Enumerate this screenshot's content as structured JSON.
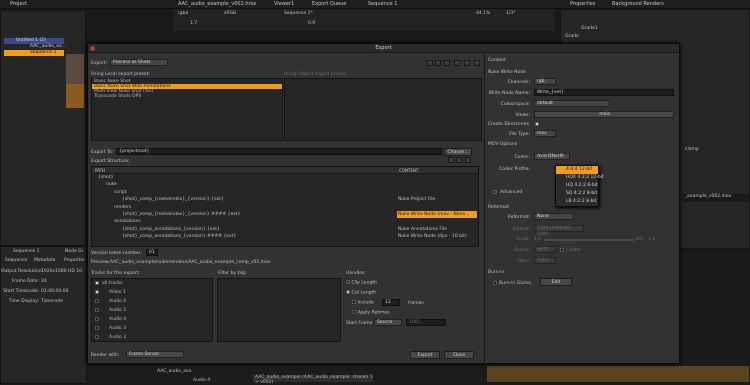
{
  "project_panel": {
    "tab": "Project",
    "rows": [
      "Untitled 1 (2)",
      "AAC_audio_ex...",
      "Sequence 1"
    ]
  },
  "top_tabs": {
    "seq_tab": "AAC_audio_example_v002.hrox",
    "viewer_tab": "Viewer1",
    "export_queue_tab": "Export Queue",
    "sequence_tab": "Sequence 1",
    "properties_tab": "Properties",
    "bg_renders_tab": "Background Renders"
  },
  "viewer_bar": {
    "channel": "rgba",
    "colorspace": "sRGB",
    "seq_name": "Sequence 1*",
    "zoom": "44.1%",
    "ratio": "1/3*"
  },
  "viewer_values": {
    "gain": "1.7",
    "gamma": "0.9"
  },
  "properties": {
    "grade": "Grade",
    "grade1": "Grade1",
    "clamp": "clamp"
  },
  "dialog": {
    "title": "Export",
    "export_label": "Export:",
    "export_value": "Process as Shots",
    "using_local_label": "Using Local export preset:",
    "using_project_label": "Using Project export preset:",
    "presets": [
      "Basic Nuke Shot",
      "Basic Nuke Shot With Annotations",
      "Multi-View Nuke Shot (%v)",
      "Transcode Shots DPX"
    ],
    "export_to_label": "Export To:",
    "export_to_value": "{projectroot}",
    "choose_button": "Choose...",
    "export_structure_label": "Export Structure:",
    "col_path": "PATH",
    "col_content": "CONTENT",
    "tree": [
      {
        "path": "{shot}",
        "content": "",
        "indent": 0
      },
      {
        "path": "nuke",
        "content": "",
        "indent": 1
      },
      {
        "path": "script",
        "content": "",
        "indent": 2
      },
      {
        "path": "{shot}_comp_{nameindex}_{version}.{ext}",
        "content": "Nuke Project File",
        "indent": 3
      },
      {
        "path": "renders",
        "content": "",
        "indent": 2
      },
      {
        "path": "{shot}_comp_{nameindex}_{version}.####.{ext}",
        "content": "Nuke Write Node (mov - None...",
        "indent": 3
      },
      {
        "path": "annotations",
        "content": "",
        "indent": 2
      },
      {
        "path": "{shot}_comp_annotations_{version}.{ext}",
        "content": "Nuke Annotations File",
        "indent": 3
      },
      {
        "path": "{shot}_comp_annotations_{version}.####.{ext}",
        "content": "Nuke Write Node (dpx - 10 bit)",
        "indent": 3
      }
    ],
    "version_label": "Version token number:",
    "version_value": "01",
    "preview_label": "Preview:",
    "preview_value": "AAC_audio_example/nuke/renders/AAC_audio_example_comp_v01.mov",
    "tracks_label": "Tracks for this export:",
    "tracks": [
      "all tracks",
      "Video 1",
      "Audio 6",
      "Audio 5",
      "Audio 4",
      "Audio 3",
      "Audio 2"
    ],
    "filter_label": "Filter by tag:",
    "handles_label": "Handles:",
    "clip_length": "Clip Length",
    "cut_length": "Cut Length",
    "include_label": "Include",
    "include_value": "12",
    "frames_label": "frames",
    "apply_retimes": "Apply Retimes",
    "start_frame_label": "Start Frame",
    "start_frame_mode": "Source",
    "start_frame_value": "1001",
    "render_with_label": "Render with:",
    "render_with_value": "Frame Server",
    "export_button": "Export",
    "close_button": "Close",
    "content": {
      "header": "Content",
      "section": "Nuke Write Node",
      "channels_label": "Channels:",
      "channels_value": "rgb",
      "write_node_label": "Write Node Name:",
      "write_node_value": "Write_{ext}",
      "colourspace_label": "Colourspace:",
      "colourspace_value": "default",
      "views_label": "Views:",
      "views_value": "main",
      "create_dirs_label": "Create Directories:",
      "file_type_label": "File Type:",
      "file_type_value": "mov",
      "mov_options": "MOV Options",
      "codec_label": "Codec:",
      "codec_value": "Avid DNxHR",
      "codec_profile_label": "Codec Profile:",
      "codec_profiles": [
        "4:4:4 12-bit",
        "HQX 4:2:2 12-bit",
        "HQ 4:2:2 8-bit",
        "SQ 4:2:2 8-bit",
        "LB 4:2:2 8-bit"
      ],
      "advanced_label": "Advanced",
      "reformat_header": "Reformat",
      "reformat_label": "Reformat:",
      "reformat_value": "None",
      "format_label": "Format:",
      "format_value": "1920x1080 HD 1080",
      "scale_label": "Scale:",
      "scale_value": "1.0",
      "scale_min": "0.0",
      "scale_max": "1.0",
      "resize_label": "Resize:",
      "resize_value": "width",
      "center_label": "Center",
      "filter_label": "Filter:",
      "filter_value": "Cubic",
      "burnin_header": "Burn-in",
      "burnin_label": "Burn-in Gizmo",
      "edit_button": "Edit"
    }
  },
  "sequence_panel": {
    "tab_sequence": "Sequence 1",
    "tab_node": "Node Gr",
    "sub_tabs": [
      "Sequence",
      "Metadata",
      "Propertie"
    ],
    "rows": [
      {
        "label": "Output Resolution:",
        "value": "1920x1080 HD 10"
      },
      {
        "label": "Frame Rate:",
        "value": "24"
      },
      {
        "label": "Start Timecode:",
        "value": "01:00:00:00"
      },
      {
        "label": "Time Display:",
        "value": "Timecode"
      }
    ]
  },
  "timeline": {
    "clip": "AAC_audio_example (AAC_audio_example: stream 1 > v002)",
    "clip2": "AAC_audio_exa",
    "audio_track": "Audio 4",
    "right_clip": "_example_v002.mov"
  },
  "colors": {
    "accent": "#f39c1a",
    "bg": "#1a1a1a",
    "panel": "#262626",
    "dialog": "#323232"
  }
}
